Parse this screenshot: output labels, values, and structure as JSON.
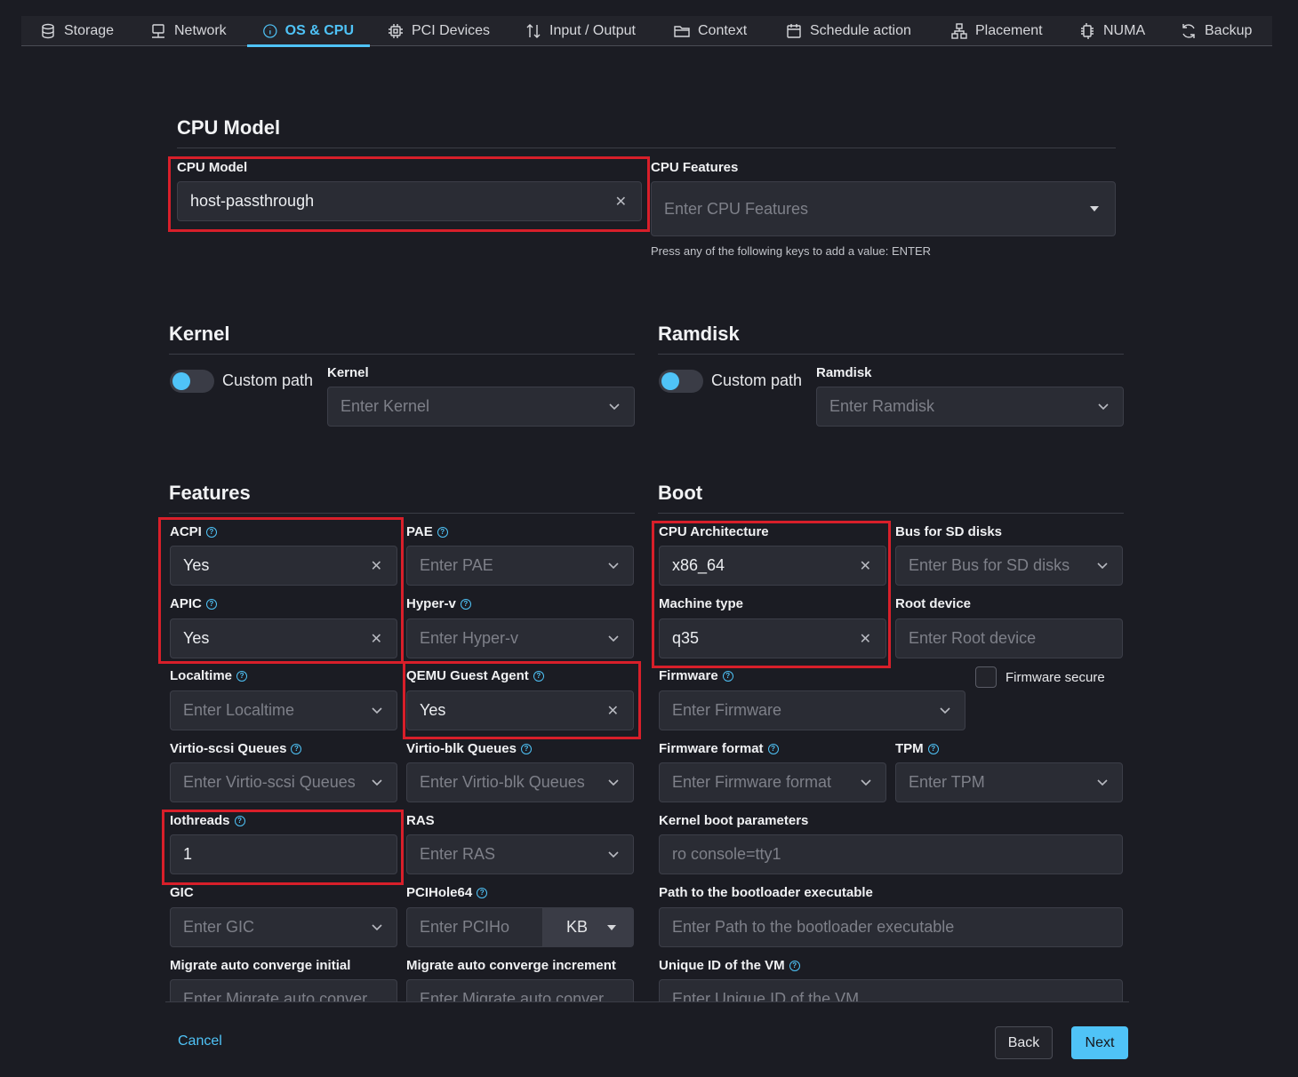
{
  "tabs": [
    {
      "label": "Storage",
      "icon": "database-icon"
    },
    {
      "label": "Network",
      "icon": "network-icon"
    },
    {
      "label": "OS & CPU",
      "icon": "info-icon",
      "active": true
    },
    {
      "label": "PCI Devices",
      "icon": "chip-icon"
    },
    {
      "label": "Input / Output",
      "icon": "arrows-updown-icon"
    },
    {
      "label": "Context",
      "icon": "folder-icon"
    },
    {
      "label": "Schedule action",
      "icon": "calendar-icon"
    },
    {
      "label": "Placement",
      "icon": "hierarchy-icon"
    },
    {
      "label": "NUMA",
      "icon": "cpu-icon"
    },
    {
      "label": "Backup",
      "icon": "refresh-icon"
    }
  ],
  "cpu_model": {
    "title": "CPU Model",
    "model_label": "CPU Model",
    "model_value": "host-passthrough",
    "features_label": "CPU Features",
    "features_placeholder": "Enter CPU Features",
    "features_hint": "Press any of the following keys to add a value: ENTER"
  },
  "kernel": {
    "title": "Kernel",
    "toggle_label": "Custom path",
    "field_label": "Kernel",
    "placeholder": "Enter Kernel"
  },
  "ramdisk": {
    "title": "Ramdisk",
    "toggle_label": "Custom path",
    "field_label": "Ramdisk",
    "placeholder": "Enter Ramdisk"
  },
  "features": {
    "title": "Features",
    "acpi": {
      "label": "ACPI",
      "value": "Yes"
    },
    "pae": {
      "label": "PAE",
      "placeholder": "Enter PAE"
    },
    "apic": {
      "label": "APIC",
      "value": "Yes"
    },
    "hyperv": {
      "label": "Hyper-v",
      "placeholder": "Enter Hyper-v"
    },
    "localtime": {
      "label": "Localtime",
      "placeholder": "Enter Localtime"
    },
    "guest_agent": {
      "label": "QEMU Guest Agent",
      "value": "Yes"
    },
    "scsi_queues": {
      "label": "Virtio-scsi Queues",
      "placeholder": "Enter Virtio-scsi Queues"
    },
    "blk_queues": {
      "label": "Virtio-blk Queues",
      "placeholder": "Enter Virtio-blk Queues"
    },
    "iothreads": {
      "label": "Iothreads",
      "value": "1"
    },
    "ras": {
      "label": "RAS",
      "placeholder": "Enter RAS"
    },
    "gic": {
      "label": "GIC",
      "placeholder": "Enter GIC"
    },
    "pcihole": {
      "label": "PCIHole64",
      "placeholder": "Enter PCIHo",
      "unit": "KB"
    },
    "migrate_initial": {
      "label": "Migrate auto converge initial",
      "placeholder": "Enter Migrate auto conver"
    },
    "migrate_increment": {
      "label": "Migrate auto converge increment",
      "placeholder": "Enter Migrate auto conver"
    }
  },
  "boot": {
    "title": "Boot",
    "arch": {
      "label": "CPU Architecture",
      "value": "x86_64"
    },
    "sd_bus": {
      "label": "Bus for SD disks",
      "placeholder": "Enter Bus for SD disks"
    },
    "machine": {
      "label": "Machine type",
      "value": "q35"
    },
    "root": {
      "label": "Root device",
      "placeholder": "Enter Root device"
    },
    "firmware": {
      "label": "Firmware",
      "placeholder": "Enter Firmware"
    },
    "firmware_secure": {
      "label": "Firmware secure"
    },
    "firmware_format": {
      "label": "Firmware format",
      "placeholder": "Enter Firmware format"
    },
    "tpm": {
      "label": "TPM",
      "placeholder": "Enter TPM"
    },
    "kernel_params": {
      "label": "Kernel boot parameters",
      "placeholder": "ro console=tty1"
    },
    "bootloader": {
      "label": "Path to the bootloader executable",
      "placeholder": "Enter Path to the bootloader executable"
    },
    "uuid": {
      "label": "Unique ID of the VM",
      "placeholder": "Enter Unique ID of the VM"
    }
  },
  "footer": {
    "cancel": "Cancel",
    "back": "Back",
    "next": "Next"
  },
  "colors": {
    "accent": "#4fc3f7",
    "highlight": "#d81f2a",
    "background": "#1b1c23"
  }
}
